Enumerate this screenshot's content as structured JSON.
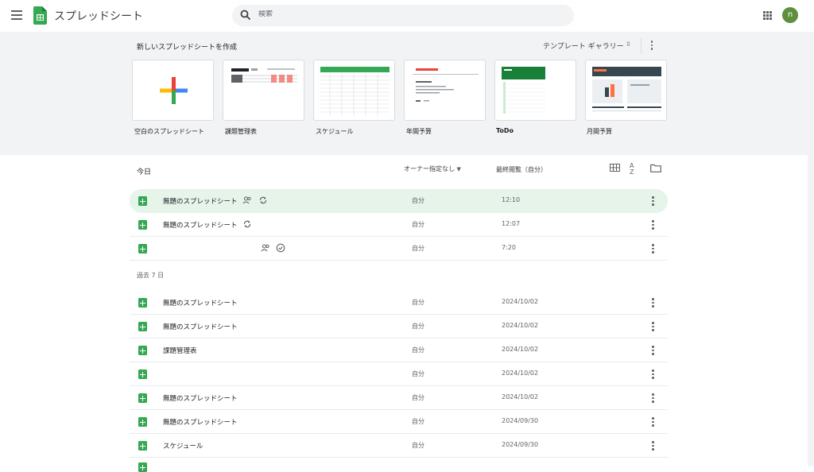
{
  "app": {
    "title": "スプレッドシート",
    "avatar_letter": "n"
  },
  "search": {
    "placeholder": "検索"
  },
  "templates": {
    "heading": "新しいスプレッドシートを作成",
    "gallery_label": "テンプレート ギャラリー",
    "items": [
      {
        "label": "空白のスプレッドシート"
      },
      {
        "label": "課題管理表"
      },
      {
        "label": "スケジュール"
      },
      {
        "label": "年間予算"
      },
      {
        "label": "ToDo"
      },
      {
        "label": "月間予算"
      }
    ]
  },
  "list": {
    "section_today": "今日",
    "owner_filter": "オーナー指定なし",
    "sort_label": "最終閲覧（自分）",
    "section_week": "過去 7 日",
    "today_rows": [
      {
        "name": "無題のスプレッドシート",
        "owner": "自分",
        "date": "12:10",
        "shared": true,
        "sync": true
      },
      {
        "name": "無題のスプレッドシート",
        "owner": "自分",
        "date": "12:07",
        "shared": false,
        "sync": true
      },
      {
        "name": "",
        "owner": "自分",
        "date": "7:20",
        "shared": true,
        "sync": false
      }
    ],
    "week_rows": [
      {
        "name": "無題のスプレッドシート",
        "owner": "自分",
        "date": "2024/10/02"
      },
      {
        "name": "無題のスプレッドシート",
        "owner": "自分",
        "date": "2024/10/02"
      },
      {
        "name": "課題管理表",
        "owner": "自分",
        "date": "2024/10/02"
      },
      {
        "name": "",
        "owner": "自分",
        "date": "2024/10/02"
      },
      {
        "name": "無題のスプレッドシート",
        "owner": "自分",
        "date": "2024/10/02"
      },
      {
        "name": "無題のスプレッドシート",
        "owner": "自分",
        "date": "2024/09/30"
      },
      {
        "name": "スケジュール",
        "owner": "自分",
        "date": "2024/09/30"
      }
    ]
  },
  "colors": {
    "brand_green": "#34a853",
    "selected_row": "#e6f4ea",
    "panel_bg": "#f1f3f4"
  }
}
